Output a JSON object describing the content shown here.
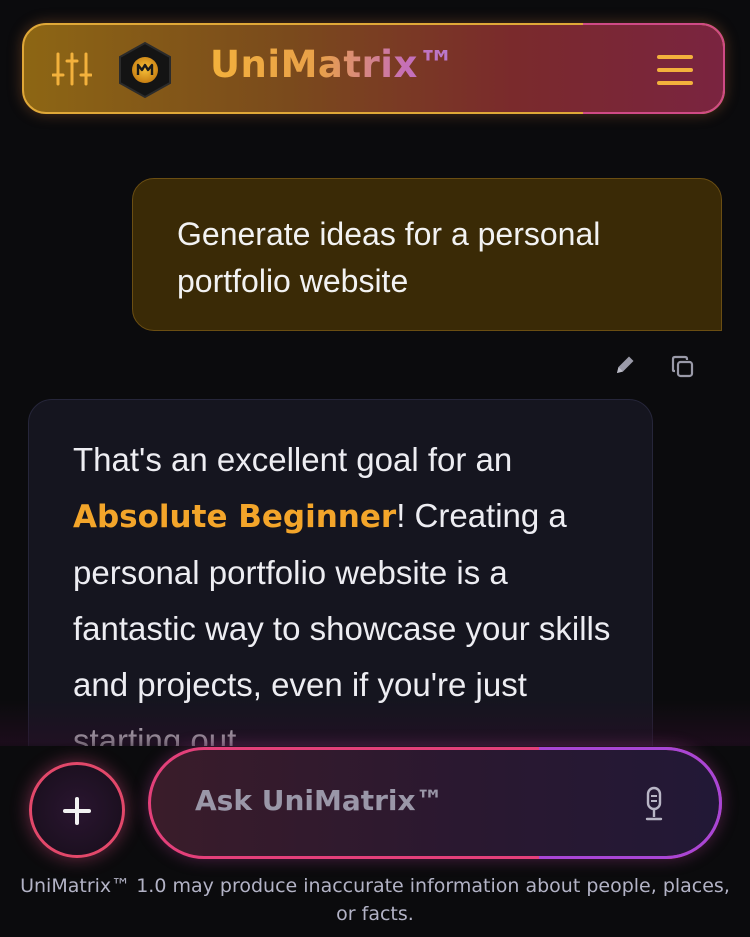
{
  "header": {
    "brand": "UniMatrix™",
    "settings_icon": "sliders-icon",
    "logo_icon": "unimatrix-logo",
    "menu_icon": "hamburger-menu-icon",
    "accent_color": "#f3b13c"
  },
  "conversation": {
    "user_message": "Generate ideas for a personal portfolio website",
    "message_actions": [
      "edit-icon",
      "copy-icon"
    ],
    "assistant_message": {
      "part1": "That's an excellent goal for an ",
      "highlight": "Absolute Beginner",
      "part2": "! Creating a personal portfolio website is a fantastic way to showcase your skills and projects, even if you're just starting out."
    }
  },
  "composer": {
    "plus_icon": "plus-icon",
    "placeholder": "Ask UniMatrix™",
    "mic_icon": "microphone-icon"
  },
  "footer": {
    "disclaimer": "UniMatrix™ 1.0 may produce inaccurate information about people, places, or facts."
  }
}
